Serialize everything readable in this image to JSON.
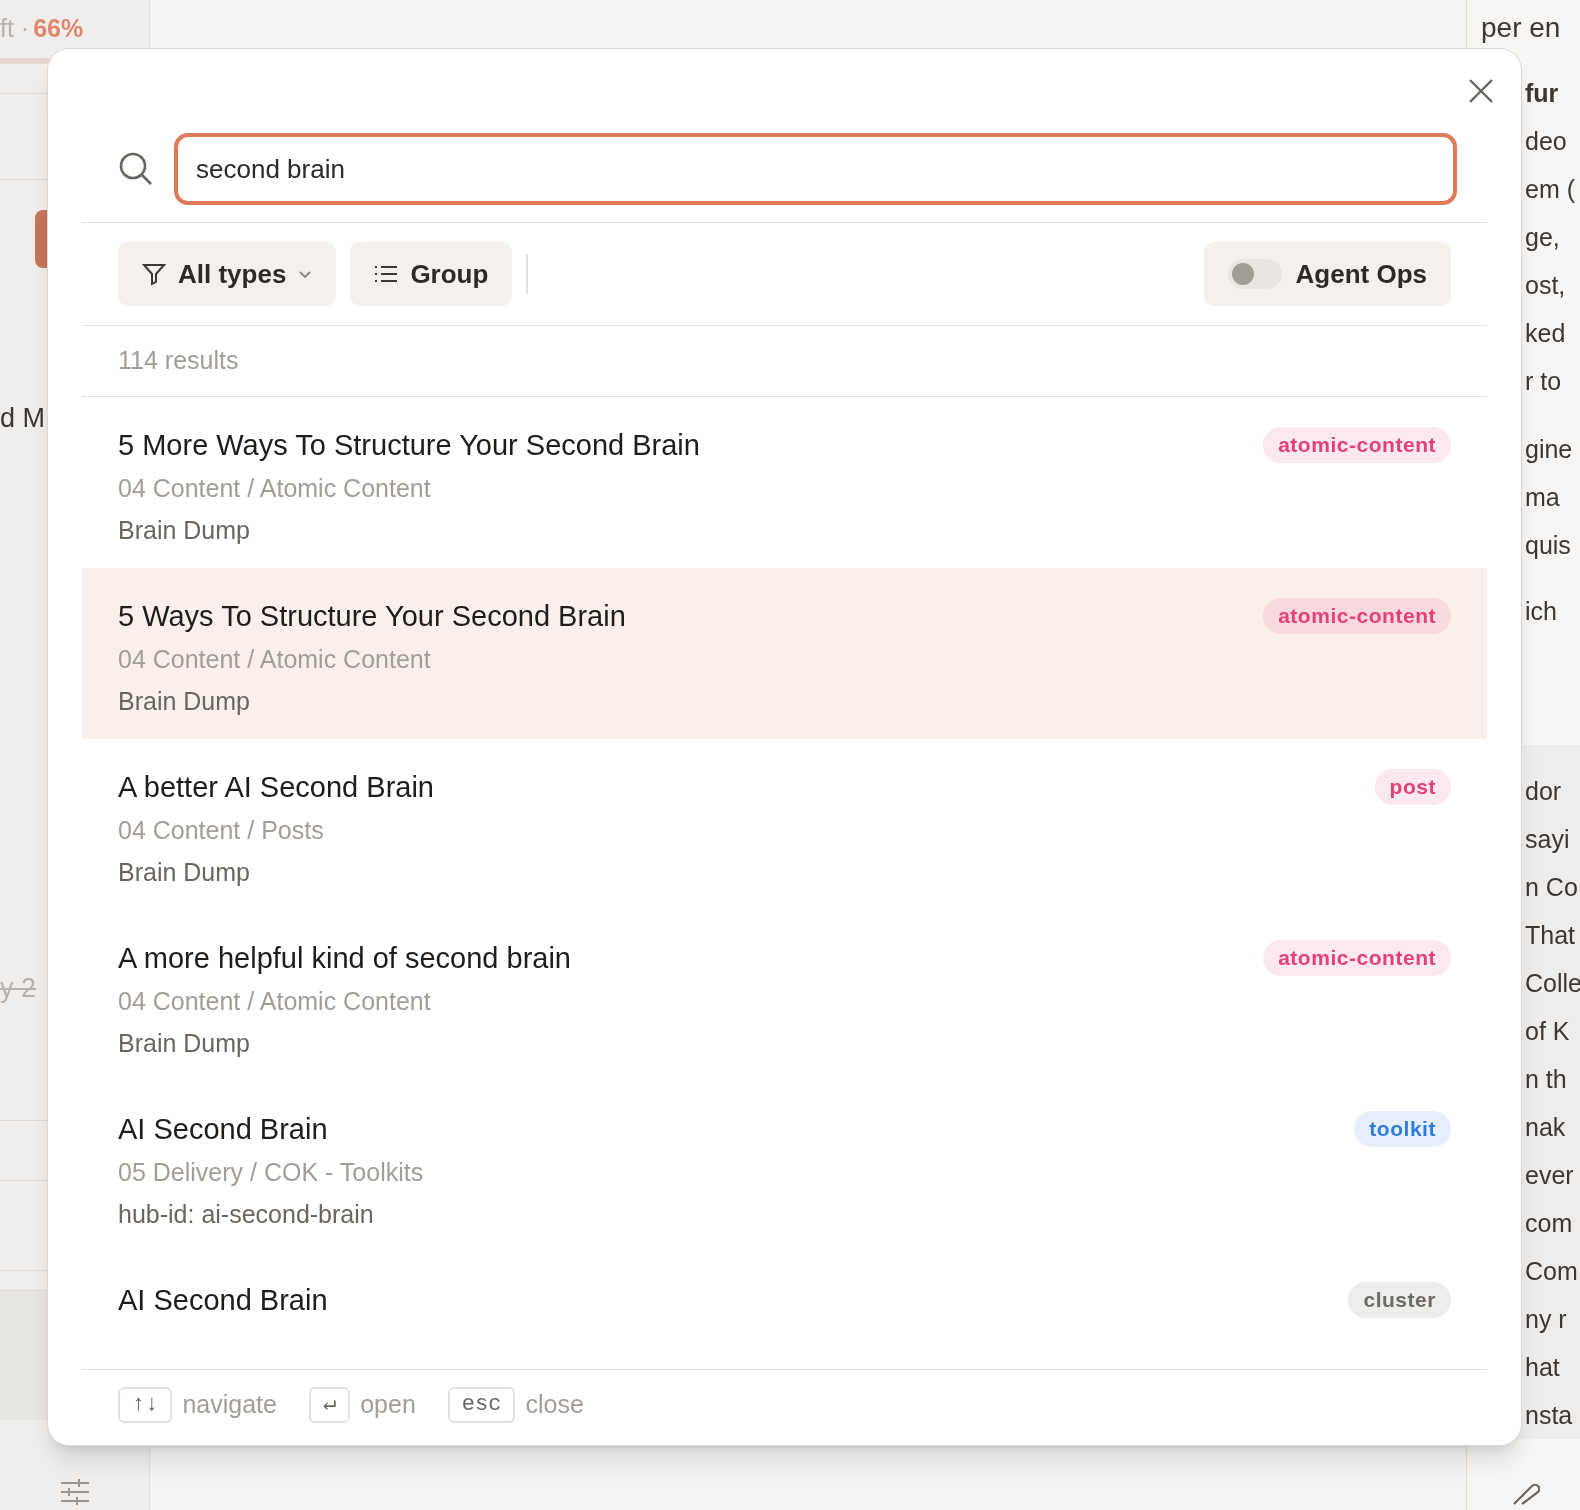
{
  "background": {
    "left": {
      "status": "ft ·",
      "zoom": "66%",
      "fragments": [
        {
          "text": "d M",
          "struck": false
        },
        {
          "text": "y 2",
          "struck": true
        }
      ]
    },
    "right": {
      "top": "per en",
      "paragraphs": [
        {
          "heading": "fur",
          "lines": [
            "deo",
            "em (",
            "ge,",
            "ost,",
            "ked",
            "r to"
          ]
        },
        {
          "lines": [
            "gine",
            "ma",
            "quis"
          ]
        },
        {
          "lines": [
            "ich"
          ]
        },
        {
          "lines": [
            "dor",
            "sayi",
            "n Co",
            "That",
            "Colle",
            "of K",
            "n th",
            "nak",
            "ever",
            "com",
            "Com",
            "ny r",
            "hat",
            "nsta"
          ]
        }
      ]
    }
  },
  "search": {
    "value": "second brain"
  },
  "filters": {
    "type_filter": "All types",
    "group": "Group",
    "agent_ops": {
      "label": "Agent Ops",
      "on": false
    }
  },
  "result_count": "114 results",
  "results": [
    {
      "title": "5 More Ways To Structure Your Second Brain",
      "path": "04 Content / Atomic Content",
      "note": "Brain Dump",
      "tag": "atomic-content",
      "color": "#e6407a",
      "selected": false
    },
    {
      "title": "5 Ways To Structure Your Second Brain",
      "path": "04 Content / Atomic Content",
      "note": "Brain Dump",
      "tag": "atomic-content",
      "color": "#e6407a",
      "selected": true
    },
    {
      "title": "A better AI Second Brain",
      "path": "04 Content / Posts",
      "note": "Brain Dump",
      "tag": "post",
      "color": "#e6407a",
      "selected": false
    },
    {
      "title": "A more helpful kind of second brain",
      "path": "04 Content / Atomic Content",
      "note": "Brain Dump",
      "tag": "atomic-content",
      "color": "#e6407a",
      "selected": false
    },
    {
      "title": "AI Second Brain",
      "path": "05 Delivery / COK - Toolkits",
      "note": "hub-id: ai-second-brain",
      "tag": "toolkit",
      "color": "#2f7de1",
      "selected": false
    },
    {
      "title": "AI Second Brain",
      "tag": "cluster",
      "color": "#6e6a66",
      "selected": false
    }
  ],
  "footer": [
    {
      "key": "↑↓",
      "label": "navigate"
    },
    {
      "key": "↵",
      "label": "open"
    },
    {
      "key": "esc",
      "label": "close"
    }
  ]
}
